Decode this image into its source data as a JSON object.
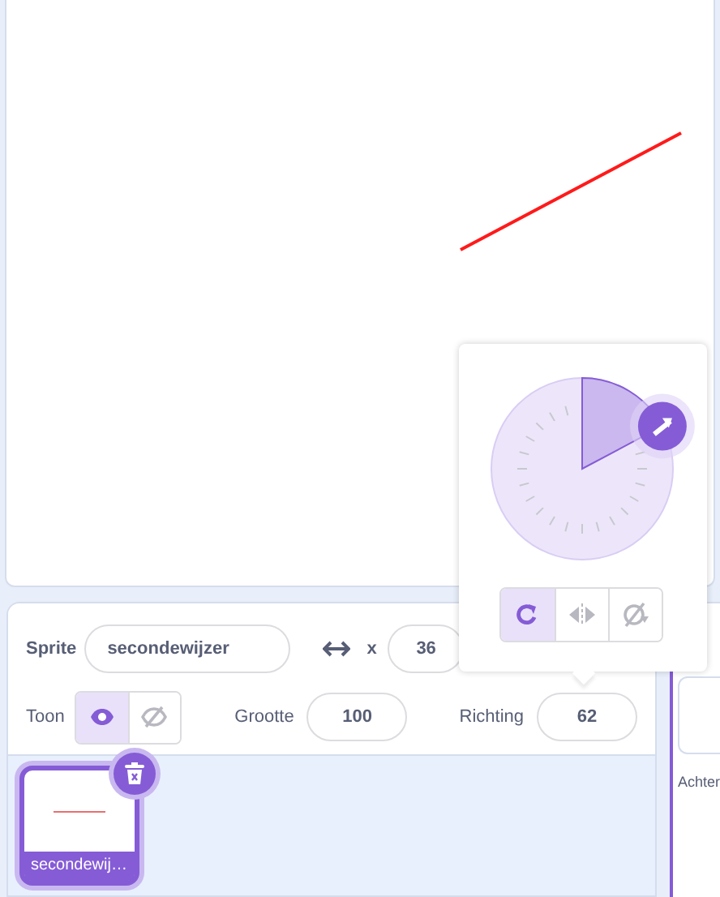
{
  "stage": {
    "kind": "line"
  },
  "sprite_info": {
    "sprite_label": "Sprite",
    "sprite_name": "secondewijzer",
    "x_label": "x",
    "x_value": "36",
    "show_label": "Toon",
    "show_buttons": [
      {
        "kind": "visible",
        "selected": true
      },
      {
        "kind": "hidden",
        "selected": false
      }
    ],
    "size_label": "Grootte",
    "size_value": "100",
    "direction_label": "Richting",
    "direction_value": "62"
  },
  "direction_popover": {
    "rotation_styles": [
      {
        "kind": "all-around",
        "selected": true
      },
      {
        "kind": "left-right",
        "selected": false
      },
      {
        "kind": "dont-rotate",
        "selected": false
      }
    ]
  },
  "sprites": [
    {
      "name": "secondewij…",
      "selected": true
    }
  ],
  "stage_pane": {
    "backdrops_label": "Achter"
  }
}
